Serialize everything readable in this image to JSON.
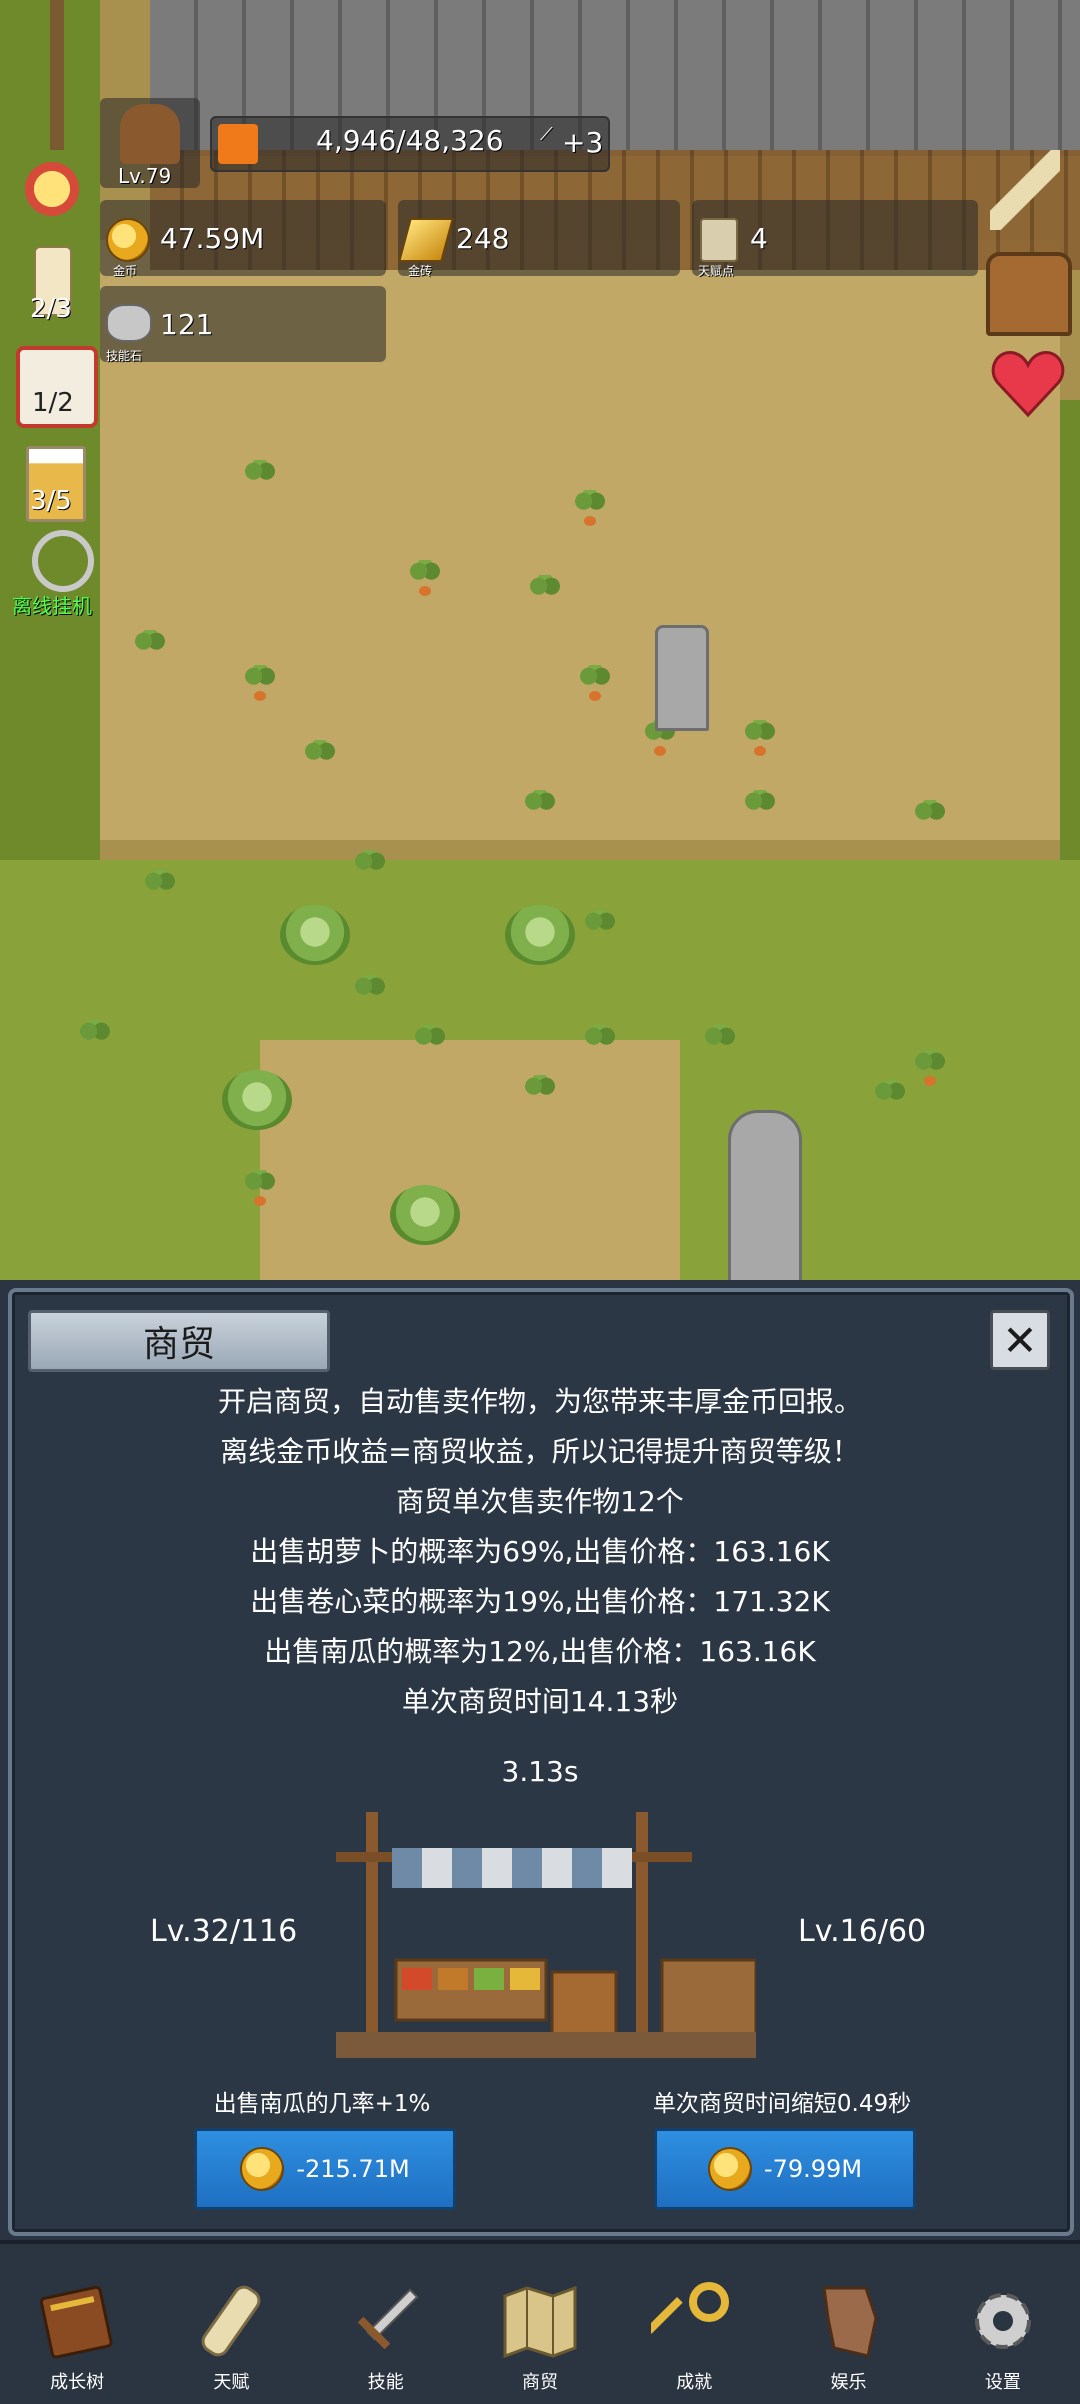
{
  "hud": {
    "level": "Lv.79",
    "exp": "4,946/48,326",
    "exp_bonus": "+3",
    "gold_value": "47.59M",
    "gold_label": "金币",
    "gold_brick_value": "248",
    "gold_brick_label": "金砖",
    "talent_value": "4",
    "talent_label": "天赋点",
    "skill_stone_value": "121",
    "skill_stone_label": "技能石",
    "candle_count": "2/3",
    "dice_count": "1/2",
    "beer_count": "3/5",
    "offline_label": "离线挂机"
  },
  "panel": {
    "title": "商贸",
    "close_icon": "close-icon",
    "lines": [
      "开启商贸，自动售卖作物，为您带来丰厚金币回报。",
      "离线金币收益=商贸收益，所以记得提升商贸等级！",
      "商贸单次售卖作物12个",
      "出售胡萝卜的概率为69%,出售价格：163.16K",
      "出售卷心菜的概率为19%,出售价格：171.32K",
      "出售南瓜的概率为12%,出售价格：163.16K",
      "单次商贸时间14.13秒"
    ],
    "timer": "3.13s",
    "left_level": "Lv.32/116",
    "right_level": "Lv.16/60",
    "left_upgrade_label": "出售南瓜的几率+1%",
    "right_upgrade_label": "单次商贸时间缩短0.49秒",
    "left_upgrade_cost": "-215.71M",
    "right_upgrade_cost": "-79.99M"
  },
  "nav": [
    {
      "label": "成长树",
      "icon": "book-icon"
    },
    {
      "label": "天赋",
      "icon": "scroll-icon"
    },
    {
      "label": "技能",
      "icon": "sword-icon"
    },
    {
      "label": "商贸",
      "icon": "map-icon"
    },
    {
      "label": "成就",
      "icon": "key-icon"
    },
    {
      "label": "娱乐",
      "icon": "parchment-icon"
    },
    {
      "label": "设置",
      "icon": "gear-icon"
    }
  ],
  "colors": {
    "panel_bg": "#2c3746",
    "button_blue": "#1f6fc2",
    "exp_orange": "#f07a1a",
    "offline_green": "#4cff4c"
  }
}
